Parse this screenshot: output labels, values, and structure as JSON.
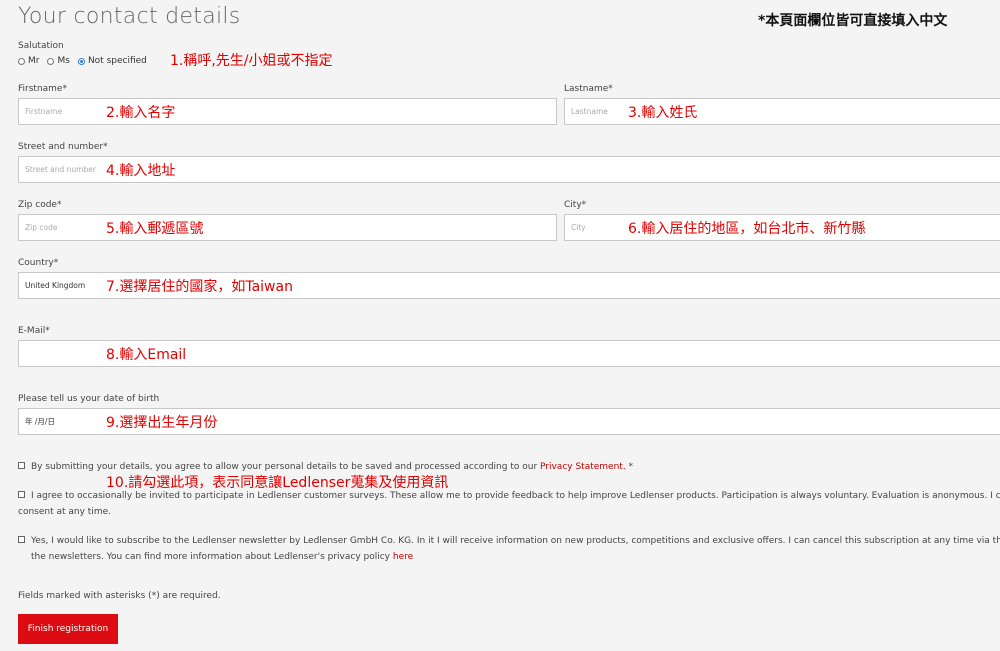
{
  "header": {
    "title": "Your contact details",
    "note": "*本頁面欄位皆可直接填入中文"
  },
  "salutation": {
    "label": "Salutation",
    "options": [
      "Mr",
      "Ms",
      "Not specified"
    ],
    "selected": "Not specified",
    "annotation": "1.稱呼,先生/小姐或不指定"
  },
  "firstname": {
    "label": "Firstname*",
    "placeholder": "Firstname",
    "annotation": "2.輸入名字"
  },
  "lastname": {
    "label": "Lastname*",
    "placeholder": "Lastname",
    "annotation": "3.輸入姓氏"
  },
  "street": {
    "label": "Street and number*",
    "placeholder": "Street and number",
    "annotation": "4.輸入地址"
  },
  "zip": {
    "label": "Zip code*",
    "placeholder": "Zip code",
    "annotation": "5.輸入郵遞區號"
  },
  "city": {
    "label": "City*",
    "placeholder": "City",
    "annotation": "6.輸入居住的地區，如台北市、新竹縣"
  },
  "country": {
    "label": "Country*",
    "value": "United Kingdom",
    "annotation": "7.選擇居住的國家，如Taiwan"
  },
  "email": {
    "label": "E-Mail*",
    "value": "",
    "annotation": "8.輸入Email"
  },
  "birth": {
    "label": "Please tell us your date of birth",
    "placeholder": "年 /月/日",
    "annotation": "9.選擇出生年月份"
  },
  "consents": {
    "privacy_text": "By submitting your details, you agree to allow your personal details to be saved and processed according to our",
    "privacy_link": "Privacy Statement.",
    "privacy_suffix": " *",
    "annotation": "10.請勾選此項，表示同意讓Ledlenser蒐集及使用資訊",
    "survey_line1": "I agree to occasionally be invited to participate in Ledlenser customer surveys. These allow me to provide feedback to help improve Ledlenser products. Participation is always voluntary. Evaluation is anonymous. I can",
    "survey_line2": "consent at any time.",
    "newsletter_line1": "Yes, I would like to subscribe to the Ledlenser newsletter by Ledlenser GmbH Co. KG. In it I will receive information on new products, competitions and exclusive offers. I can cancel this subscription at any time via the",
    "newsletter_line2": "the newsletters. You can find more information about Ledlenser's privacy policy",
    "newsletter_link": "here"
  },
  "footer": {
    "required_note": "Fields marked with asterisks (*) are required.",
    "submit_label": "Finish registration"
  },
  "colors": {
    "accent": "#dc0c12",
    "annotation": "#e00000",
    "background": "#f4f4f4"
  }
}
